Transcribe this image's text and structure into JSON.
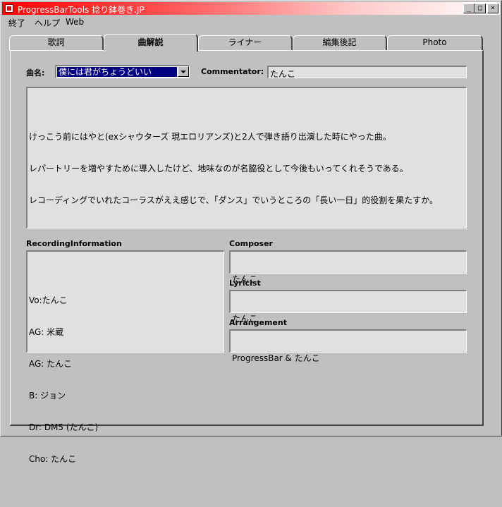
{
  "window": {
    "title": "ProgressBarTools 捻り鉢巻き.JP",
    "min_label": "_",
    "max_label": "□",
    "close_label": "×"
  },
  "menu": [
    "終了",
    "ヘルプ",
    "Web"
  ],
  "tabs": [
    {
      "label": "歌詞",
      "active": false
    },
    {
      "label": "曲解説",
      "active": true
    },
    {
      "label": "ライナー",
      "active": false
    },
    {
      "label": "編集後記",
      "active": false
    },
    {
      "label": "Photo",
      "active": false
    }
  ],
  "song": {
    "label": "曲名:",
    "selected": "僕には君がちょうどいい"
  },
  "commentator": {
    "label": "Commentator:",
    "value": "たんこ"
  },
  "comment": [
    "けっこう前にはやと(exシャウターズ 現エロリアンズ)と2人で弾き語り出演した時にやった曲。",
    "レパートリーを増やすために導入したけど、地味なのが名脇役として今後もいってくれそうである。",
    "レコーディングでいれたコーラスがええ感じで、「ダンス」でいうところの「長い一日」的役割を果たすか。"
  ],
  "recording": {
    "label": "RecordingInformation",
    "lines": [
      "Vo:たんこ",
      "AG: 米蔵",
      "AG: たんこ",
      "B: ジョン",
      "Dr: DM5 (たんこ)",
      "Cho: たんこ"
    ]
  },
  "composer": {
    "label": "Composer",
    "value": "たんこ"
  },
  "lyricist": {
    "label": "Lyricist",
    "value": "たんこ"
  },
  "arrangement": {
    "label": "Arrangement",
    "value": "ProgressBar & たんこ"
  },
  "colors": {
    "title_start": "#ff0000",
    "selection": "#000080",
    "face": "#c0c0c0",
    "field": "#e0e0e0"
  }
}
